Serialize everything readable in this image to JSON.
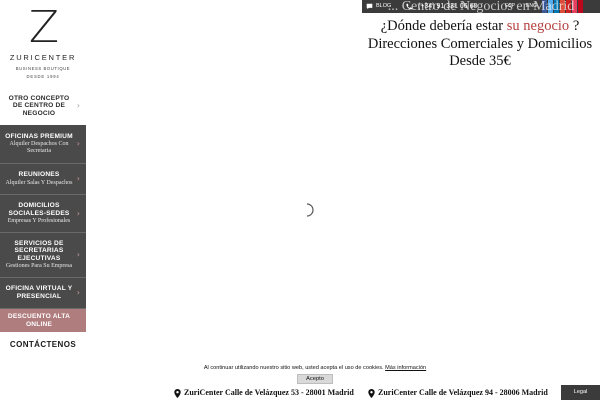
{
  "logo": {
    "brand": "ZURICENTER",
    "tagline": "BUSINESS BOUTIQUE",
    "since": "DESDE 1994"
  },
  "sidebar": {
    "items": [
      {
        "title": "OTRO CONCEPTO DE CENTRO DE NEGOCIO",
        "desc": ""
      },
      {
        "title": "OFICINAS PREMIUM",
        "desc": "Alquiler Despachos Con Secretaria"
      },
      {
        "title": "REUNIONES",
        "desc": "Alquiler Salas Y Despachos"
      },
      {
        "title": "DOMICILIOS SOCIALES-SEDES",
        "desc": "Empresas Y Profesionales"
      },
      {
        "title": "SERVICIOS DE SECRETARIAS EJECUTIVAS",
        "desc": "Gestiones Para Su Empresa"
      },
      {
        "title": "OFICINA VIRTUAL Y PRESENCIAL",
        "desc": ""
      },
      {
        "title": "DESCUENTO ALTA ONLINE",
        "desc": ""
      }
    ],
    "contact": "CONTÁCTENOS"
  },
  "topbar": {
    "blog": "BLOG",
    "phone": "(+34) 91 331 06 60",
    "lang_es": "ESP",
    "lang_en": "ENG"
  },
  "hero": {
    "overlay_text": "... Centro de Negocios en Madrid",
    "line1_before": "¿Dónde debería estar",
    "line1_highlight": "su negocio",
    "line1_after": "?",
    "line2": "Direcciones Comerciales y Domicilios",
    "line3": "Desde 35€"
  },
  "cookie": {
    "text": "Al continuar utilizando nuestro sitio web, usted acepta el uso de cookies.",
    "link": "Más información",
    "accept": "Acepto"
  },
  "footer": {
    "address1": "ZuriCenter Calle de Velázquez 53 - 28001 Madrid",
    "address2": "ZuriCenter Calle de Velázquez 94 - 28006 Madrid",
    "legal": "Legal"
  },
  "colors": {
    "sidebar_dark": "#4a4a4a",
    "accent": "#b07d7f",
    "highlight_text": "#b3413f",
    "topbar": "#3b3b3b"
  }
}
